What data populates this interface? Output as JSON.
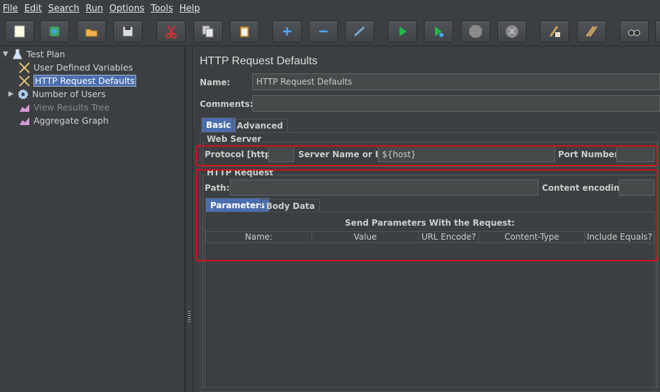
{
  "menu": [
    "File",
    "Edit",
    "Search",
    "Run",
    "Options",
    "Tools",
    "Help"
  ],
  "toolbar": {
    "buttons": [
      "new",
      "templates",
      "open",
      "save",
      "cut",
      "copy",
      "paste",
      "expand",
      "collapse",
      "toggle",
      "start",
      "start-no-pauses",
      "stop",
      "shutdown",
      "clear",
      "clear-all",
      "search"
    ]
  },
  "tree": {
    "items": [
      {
        "label": "Test Plan"
      },
      {
        "label": "User Defined Variables"
      },
      {
        "label": "HTTP Request Defaults"
      },
      {
        "label": "Number of Users"
      },
      {
        "label": "View Results Tree"
      },
      {
        "label": "Aggregate Graph"
      }
    ]
  },
  "form": {
    "title": "HTTP Request Defaults",
    "name_label": "Name:",
    "name_value": "HTTP Request Defaults",
    "comments_label": "Comments:",
    "comments_value": "",
    "tabs": [
      "Basic",
      "Advanced"
    ],
    "web_server": {
      "title": "Web Server",
      "protocol_label": "Protocol [http]:",
      "protocol_value": "",
      "server_label": "Server Name or IP:",
      "server_value": "${host}",
      "port_label": "Port Number:",
      "port_value": ""
    },
    "http_request": {
      "title": "HTTP Request",
      "path_label": "Path:",
      "path_value": "",
      "encoding_label": "Content encoding:",
      "encoding_value": "",
      "subtabs": [
        "Parameters",
        "Body Data"
      ],
      "table_title": "Send Parameters With the Request:",
      "columns": [
        "Name:",
        "Value",
        "URL Encode?",
        "Content-Type",
        "Include Equals?"
      ]
    }
  }
}
